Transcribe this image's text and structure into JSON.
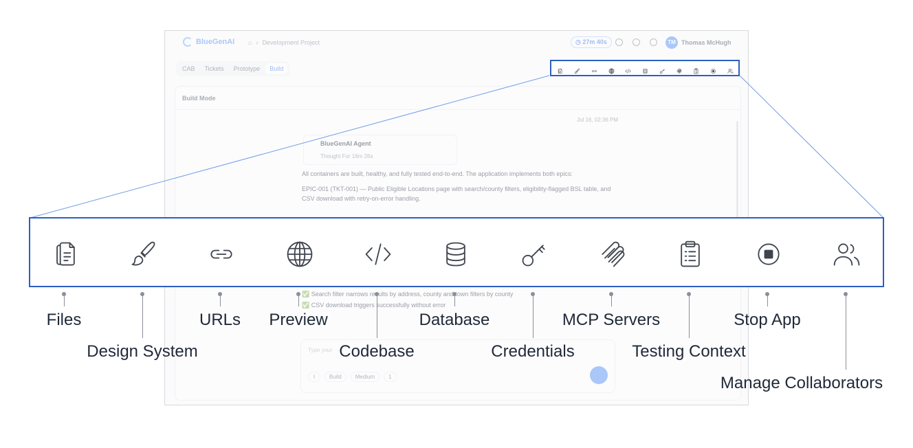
{
  "app": {
    "brand": "BlueGenAI",
    "breadcrumb": "Development Project",
    "timer": "27m 40s",
    "user_initials": "TM",
    "user_name": "Thomas McHugh",
    "mode_tabs": [
      "CAB",
      "Tickets",
      "Prototype",
      "Build"
    ],
    "active_mode": "Build",
    "panel_title": "Build Mode",
    "timestamp": "Jul 16, 02:36 PM",
    "agent_name": "BlueGenAI Agent",
    "agent_thought": "Thought For 16m 26s",
    "messages": [
      "All containers are built, healthy, and fully tested end-to-end. The application implements both epics:",
      "EPIC-001 (TKT-001) — Public Eligible Locations page with search/county filters, eligibility-flagged BSL table, and CSV download with retry-on-error handling.",
      "✅ Search filter narrows results by address, county and town filters by county",
      "✅ CSV download triggers successfully without error"
    ],
    "chat_placeholder": "Type your",
    "chat_pills": [
      "Build",
      "Medium"
    ],
    "chat_count": "1"
  },
  "toolbar": {
    "items": [
      {
        "id": "files",
        "label": "Files",
        "icon": "files-icon"
      },
      {
        "id": "design-system",
        "label": "Design System",
        "icon": "brush-icon"
      },
      {
        "id": "urls",
        "label": "URLs",
        "icon": "link-icon"
      },
      {
        "id": "preview",
        "label": "Preview",
        "icon": "globe-icon"
      },
      {
        "id": "codebase",
        "label": "Codebase",
        "icon": "code-icon"
      },
      {
        "id": "database",
        "label": "Database",
        "icon": "database-icon"
      },
      {
        "id": "credentials",
        "label": "Credentials",
        "icon": "key-icon"
      },
      {
        "id": "mcp-servers",
        "label": "MCP Servers",
        "icon": "mcp-icon"
      },
      {
        "id": "testing-context",
        "label": "Testing Context",
        "icon": "clipboard-icon"
      },
      {
        "id": "stop-app",
        "label": "Stop App",
        "icon": "stop-icon"
      },
      {
        "id": "manage-collaborators",
        "label": "Manage Collaborators",
        "icon": "users-icon"
      }
    ]
  },
  "colors": {
    "accent": "#2b5fc0",
    "icon": "#3f444e",
    "leader": "#8a8f99"
  }
}
